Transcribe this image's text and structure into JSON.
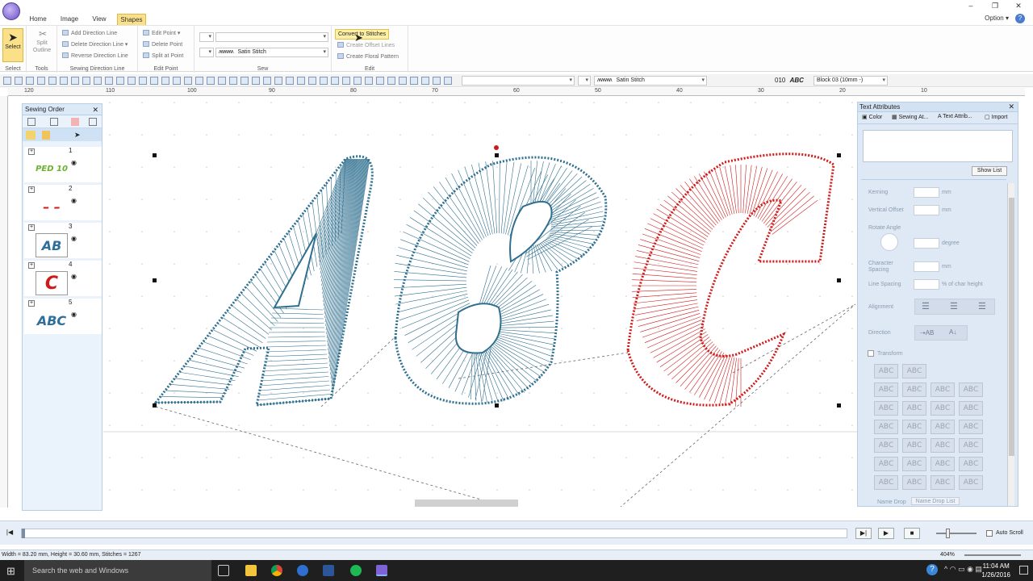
{
  "window": {
    "tabs": [
      "Home",
      "Image",
      "View",
      "Shapes"
    ],
    "active_tab": "Shapes",
    "option_label": "Option"
  },
  "ribbon": {
    "select": {
      "label": "Select",
      "group": "Select"
    },
    "tools": {
      "label": "Split Outline",
      "group": "Tools"
    },
    "sewing_direction": {
      "items": [
        "Add Direction Line",
        "Delete Direction Line",
        "Reverse Direction Line"
      ],
      "group": "Sewing Direction Line"
    },
    "edit_point": {
      "items": [
        "Edit Point",
        "Delete Point",
        "Split at Point"
      ],
      "group": "Edit Point"
    },
    "sew": {
      "stitch_type": "Satin Stitch",
      "group": "Sew"
    },
    "edit": {
      "items": [
        "Convert to Stitches",
        "Create Offset Lines",
        "Create Floral Pattern"
      ],
      "group": "Edit"
    }
  },
  "toolbar": {
    "stitch_type": "Satin Stitch",
    "font_num": "010",
    "font_sample": "ABC",
    "font_name": "Block 03",
    "font_size": "(10mm -)"
  },
  "rulers": {
    "h_ticks": [
      "120",
      "110",
      "100",
      "90",
      "80",
      "70",
      "60",
      "50",
      "40",
      "30",
      "20",
      "10"
    ]
  },
  "sewing_order": {
    "title": "Sewing Order",
    "items": [
      {
        "num": "1",
        "thumb": "PED 10",
        "color": "#6bb32e"
      },
      {
        "num": "2",
        "thumb": "– –",
        "color": "#d01a1a"
      },
      {
        "num": "3",
        "thumb": "AB",
        "color": "#2f6f9a"
      },
      {
        "num": "4",
        "thumb": "C",
        "color": "#d01a1a"
      },
      {
        "num": "5",
        "thumb": "ABC",
        "color": "#2f6f9a"
      }
    ]
  },
  "canvas": {
    "colors": {
      "blue": "#2f6f8f",
      "red": "#d01a1a"
    }
  },
  "text_attributes": {
    "title": "Text Attributes",
    "tabs": [
      "Color",
      "Sewing At...",
      "Text Attrib...",
      "Import"
    ],
    "show_list": "Show List",
    "kerning": "Kerning",
    "kerning_unit": "mm",
    "vertical_offset": "Vertical Offset",
    "vertical_unit": "mm",
    "rotate_angle": "Rotate Angle",
    "rotate_unit": "degree",
    "char_spacing": "Character Spacing",
    "char_unit": "mm",
    "line_spacing": "Line Spacing",
    "line_unit": "% of char height",
    "alignment": "Alignment",
    "direction": "Direction",
    "transform": "Transform",
    "style_sample": "ABC",
    "name_drop": "Name Drop",
    "name_drop_list": "Name Drop List"
  },
  "playback": {
    "auto_scroll": "Auto Scroll"
  },
  "status": {
    "text": "Width = 83.20 mm, Height = 30.60 mm, Stitches = 1267",
    "zoom": "404%"
  },
  "taskbar": {
    "search_placeholder": "Search the web and Windows",
    "time": "11:04 AM",
    "date": "1/26/2016"
  }
}
